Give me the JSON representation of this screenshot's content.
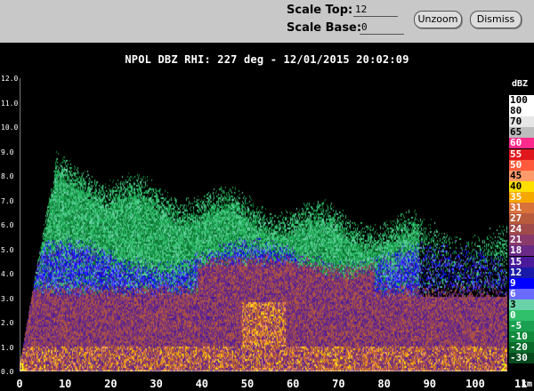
{
  "toolbar": {
    "scale_top_label": "Scale Top:",
    "scale_top_value": "12",
    "scale_base_label": "Scale Base:",
    "scale_base_value": "0",
    "unzoom_label": "Unzoom",
    "dismiss_label": "Dismiss"
  },
  "plot": {
    "title": "NPOL DBZ  RHI: 227 deg  -  12/01/2015 20:02:09",
    "y_ticks": [
      "12.0",
      "11.0",
      "10.0",
      "9.0",
      "8.0",
      "7.0",
      "6.0",
      "5.0",
      "4.0",
      "3.0",
      "2.0",
      "1.0",
      "0.0"
    ],
    "x_ticks": [
      "0",
      "10",
      "20",
      "30",
      "40",
      "50",
      "60",
      "70",
      "80",
      "90",
      "100",
      "11"
    ],
    "x_unit": "km",
    "corner_left": "1",
    "corner_right": "2"
  },
  "colorbar": {
    "unit": "dBZ",
    "entries": [
      {
        "label": "100",
        "color": "#ffffff"
      },
      {
        "label": "80",
        "color": "#ffffff"
      },
      {
        "label": "70",
        "color": "#e6e6e6"
      },
      {
        "label": "65",
        "color": "#bdbdbd"
      },
      {
        "label": "60",
        "color": "#ff2b8c"
      },
      {
        "label": "55",
        "color": "#e0181e"
      },
      {
        "label": "50",
        "color": "#ff5a3c"
      },
      {
        "label": "45",
        "color": "#ff9b6b"
      },
      {
        "label": "40",
        "color": "#ffdf00"
      },
      {
        "label": "35",
        "color": "#f7a800"
      },
      {
        "label": "31",
        "color": "#d9713a"
      },
      {
        "label": "27",
        "color": "#b85a3c"
      },
      {
        "label": "24",
        "color": "#a04a4c"
      },
      {
        "label": "21",
        "color": "#8a3a6a"
      },
      {
        "label": "18",
        "color": "#6a2a86"
      },
      {
        "label": "15",
        "color": "#4a1a9a"
      },
      {
        "label": "12",
        "color": "#1a1aa8"
      },
      {
        "label": "9",
        "color": "#0000ff"
      },
      {
        "label": "6",
        "color": "#6a6aff"
      },
      {
        "label": "3",
        "color": "#6ad2a8"
      },
      {
        "label": "0",
        "color": "#2fbf6a"
      },
      {
        "label": "-5",
        "color": "#1aa050"
      },
      {
        "label": "-10",
        "color": "#128a3c"
      },
      {
        "label": "-20",
        "color": "#0a6a2a"
      },
      {
        "label": "-30",
        "color": "#064a1e"
      }
    ]
  }
}
